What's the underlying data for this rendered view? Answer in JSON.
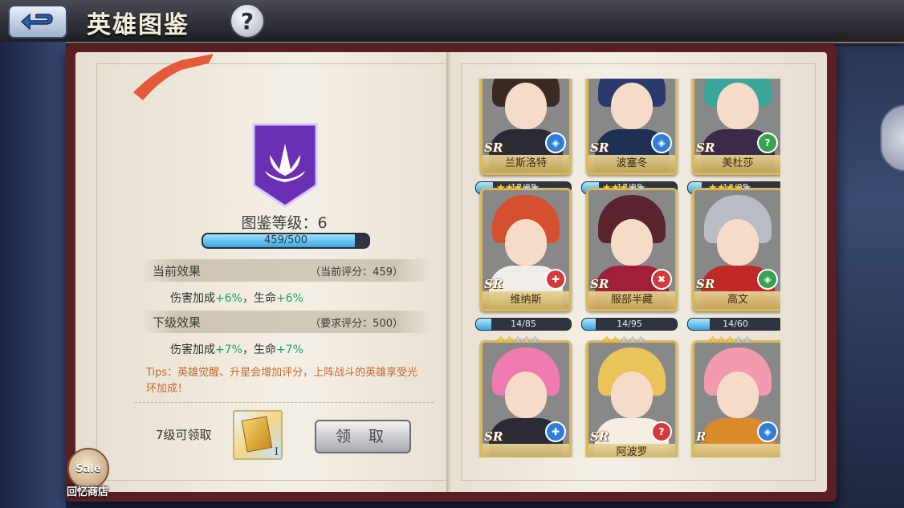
{
  "header": {
    "title": "英雄图鉴",
    "help_label": "?"
  },
  "codex": {
    "level_label": "图鉴等级：6",
    "progress_text": "459/500",
    "progress_fraction": 0.918,
    "current_effect": {
      "label": "当前效果",
      "score_text": "（当前评分：459）",
      "damage_prefix": "伤害加成",
      "damage_value": "+6%",
      "sep": "，生命",
      "hp_value": "+6%"
    },
    "next_effect": {
      "label": "下级效果",
      "score_text": "（要求评分：500）",
      "damage_prefix": "伤害加成",
      "damage_value": "+7%",
      "sep": "，生命",
      "hp_value": "+7%"
    },
    "tips": "Tips：英雄觉醒、升星会增加评分，上阵战斗的英雄享受光环加成！",
    "reward_label": "7级可领取",
    "reward_item_mark": "I",
    "claim_button": "领 取"
  },
  "shop": {
    "badge": "Sale",
    "label": "回忆商店"
  },
  "heroes": [
    {
      "name": "兰斯洛特",
      "rarity": "SR",
      "stars": 0,
      "max_stars": 5,
      "progress_text": "17/95",
      "progress": 0.179,
      "badge": "shield",
      "hair": "#3b2a22",
      "outfit": "#2b2b35",
      "badge_color": "#2f7fd6"
    },
    {
      "name": "波塞冬",
      "rarity": "SR",
      "stars": 0,
      "max_stars": 5,
      "progress_text": "17/95",
      "progress": 0.179,
      "badge": "shield",
      "hair": "#2a3a6a",
      "outfit": "#1f2f55",
      "badge_color": "#2f7fd6"
    },
    {
      "name": "美杜莎",
      "rarity": "SR",
      "stars": 0,
      "max_stars": 5,
      "progress_text": "14/95",
      "progress": 0.147,
      "badge": "question",
      "hair": "#3aa79a",
      "outfit": "#3b2a4a",
      "badge_color": "#35a34f"
    },
    {
      "name": "维纳斯",
      "rarity": "SR",
      "stars": 3,
      "max_stars": 5,
      "progress_text": "14/85",
      "progress": 0.165,
      "badge": "cross",
      "hair": "#d4502e",
      "outfit": "#f0ede8",
      "badge_color": "#d23b3b"
    },
    {
      "name": "服部半藏",
      "rarity": "SR",
      "stars": 3,
      "max_stars": 5,
      "progress_text": "14/95",
      "progress": 0.147,
      "badge": "swords",
      "hair": "#5a2430",
      "outfit": "#a0203a",
      "badge_color": "#d23b3b"
    },
    {
      "name": "高文",
      "rarity": "SR",
      "stars": 4,
      "max_stars": 5,
      "progress_text": "14/60",
      "progress": 0.233,
      "badge": "shield",
      "hair": "#b8bcc4",
      "outfit": "#c0282a",
      "badge_color": "#35a34f"
    },
    {
      "name": "",
      "rarity": "SR",
      "stars": 2,
      "max_stars": 5,
      "progress_text": "",
      "progress": 0,
      "badge": "cross",
      "hair": "#f07bb0",
      "outfit": "#2b2b35",
      "badge_color": "#2f7fd6"
    },
    {
      "name": "阿波罗",
      "rarity": "SR",
      "stars": 2,
      "max_stars": 5,
      "progress_text": "",
      "progress": 0,
      "badge": "question",
      "hair": "#e8c45a",
      "outfit": "#f3ede2",
      "badge_color": "#d23b3b"
    },
    {
      "name": "",
      "rarity": "R",
      "stars": 3,
      "max_stars": 5,
      "progress_text": "",
      "progress": 0,
      "badge": "shield",
      "hair": "#f29ab0",
      "outfit": "#d98a2a",
      "badge_color": "#2f7fd6"
    }
  ]
}
